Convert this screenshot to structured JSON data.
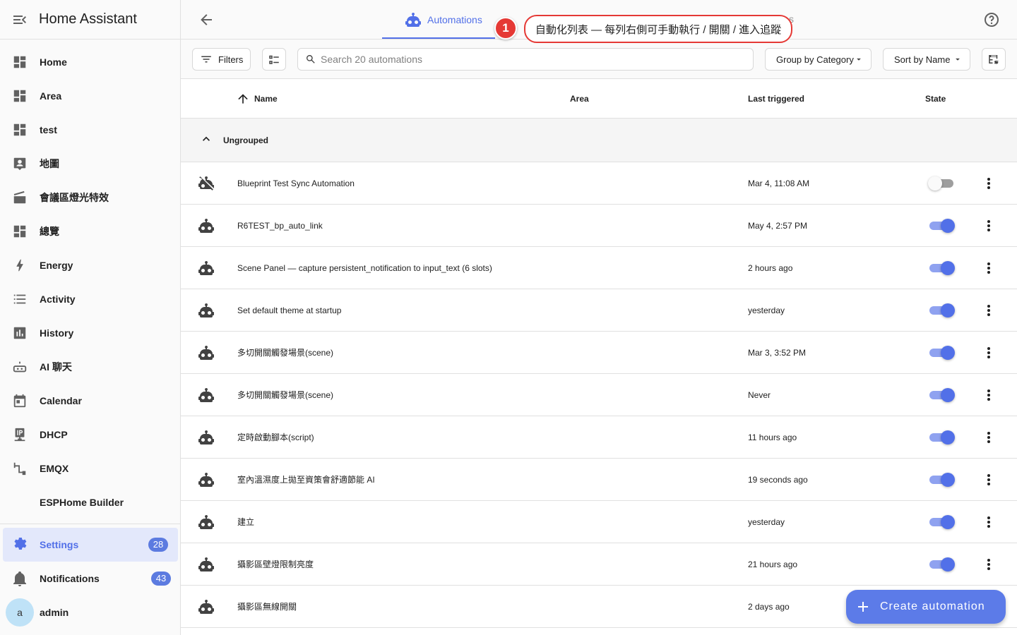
{
  "app": {
    "title": "Home Assistant"
  },
  "sidebar": {
    "items": [
      {
        "label": "Home",
        "icon": "dashboard-icon"
      },
      {
        "label": "Area",
        "icon": "dashboard-icon"
      },
      {
        "label": "test",
        "icon": "dashboard-icon"
      },
      {
        "label": "地圖",
        "icon": "map-account-icon"
      },
      {
        "label": "會議區燈光特效",
        "icon": "clapperboard-icon"
      },
      {
        "label": "總覽",
        "icon": "dashboard-icon"
      },
      {
        "label": "Energy",
        "icon": "lightning-icon"
      },
      {
        "label": "Activity",
        "icon": "list-icon"
      },
      {
        "label": "History",
        "icon": "chart-box-icon"
      },
      {
        "label": "AI 聊天",
        "icon": "robot-icon"
      },
      {
        "label": "Calendar",
        "icon": "calendar-icon"
      },
      {
        "label": "DHCP",
        "icon": "ip-network-icon"
      },
      {
        "label": "EMQX",
        "icon": "pipe-icon"
      },
      {
        "label": "ESPHome Builder",
        "icon": ""
      }
    ],
    "settings": {
      "label": "Settings",
      "badge": "28"
    },
    "notifications": {
      "label": "Notifications",
      "badge": "43"
    },
    "user": {
      "label": "admin",
      "initial": "a"
    }
  },
  "topbar": {
    "tabs": [
      {
        "label": "Automations",
        "icon": "robot-icon"
      }
    ],
    "ghost_text": "s"
  },
  "callout": {
    "number": "1",
    "text": "自動化列表 — 每列右側可手動執行 / 開關 / 進入追蹤"
  },
  "toolbar": {
    "filters_label": "Filters",
    "search_placeholder": "Search 20 automations",
    "group_by_label": "Group by Category",
    "sort_by_label": "Sort by Name"
  },
  "table": {
    "columns": {
      "name": "Name",
      "area": "Area",
      "last_triggered": "Last triggered",
      "state": "State"
    },
    "group_label": "Ungrouped",
    "rows": [
      {
        "name": "Blueprint Test Sync Automation",
        "last_triggered": "Mar 4, 11:08 AM",
        "enabled": false,
        "icon": "robot-off-icon"
      },
      {
        "name": "R6TEST_bp_auto_link",
        "last_triggered": "May 4, 2:57 PM",
        "enabled": true,
        "icon": "robot-icon"
      },
      {
        "name": "Scene Panel — capture persistent_notification to input_text (6 slots)",
        "last_triggered": "2 hours ago",
        "enabled": true,
        "icon": "robot-icon"
      },
      {
        "name": "Set default theme at startup",
        "last_triggered": "yesterday",
        "enabled": true,
        "icon": "robot-icon"
      },
      {
        "name": "多切開關觸發場景(scene)",
        "last_triggered": "Mar 3, 3:52 PM",
        "enabled": true,
        "icon": "robot-icon"
      },
      {
        "name": "多切開關觸發場景(scene)",
        "last_triggered": "Never",
        "enabled": true,
        "icon": "robot-icon"
      },
      {
        "name": "定時啟動腳本(script)",
        "last_triggered": "11 hours ago",
        "enabled": true,
        "icon": "robot-icon"
      },
      {
        "name": "室內溫濕度上拋至資策會舒適節能 AI",
        "last_triggered": "19 seconds ago",
        "enabled": true,
        "icon": "robot-icon"
      },
      {
        "name": "建立",
        "last_triggered": "yesterday",
        "enabled": true,
        "icon": "robot-icon"
      },
      {
        "name": "攝影區壁燈限制亮度",
        "last_triggered": "21 hours ago",
        "enabled": true,
        "icon": "robot-icon"
      },
      {
        "name": "攝影區無線開關",
        "last_triggered": "2 days ago",
        "enabled": true,
        "icon": "robot-icon"
      }
    ]
  },
  "fab": {
    "label": "Create automation"
  },
  "colors": {
    "primary": "#5270e8",
    "callout": "#e53935",
    "badge": "#5c7be0"
  }
}
